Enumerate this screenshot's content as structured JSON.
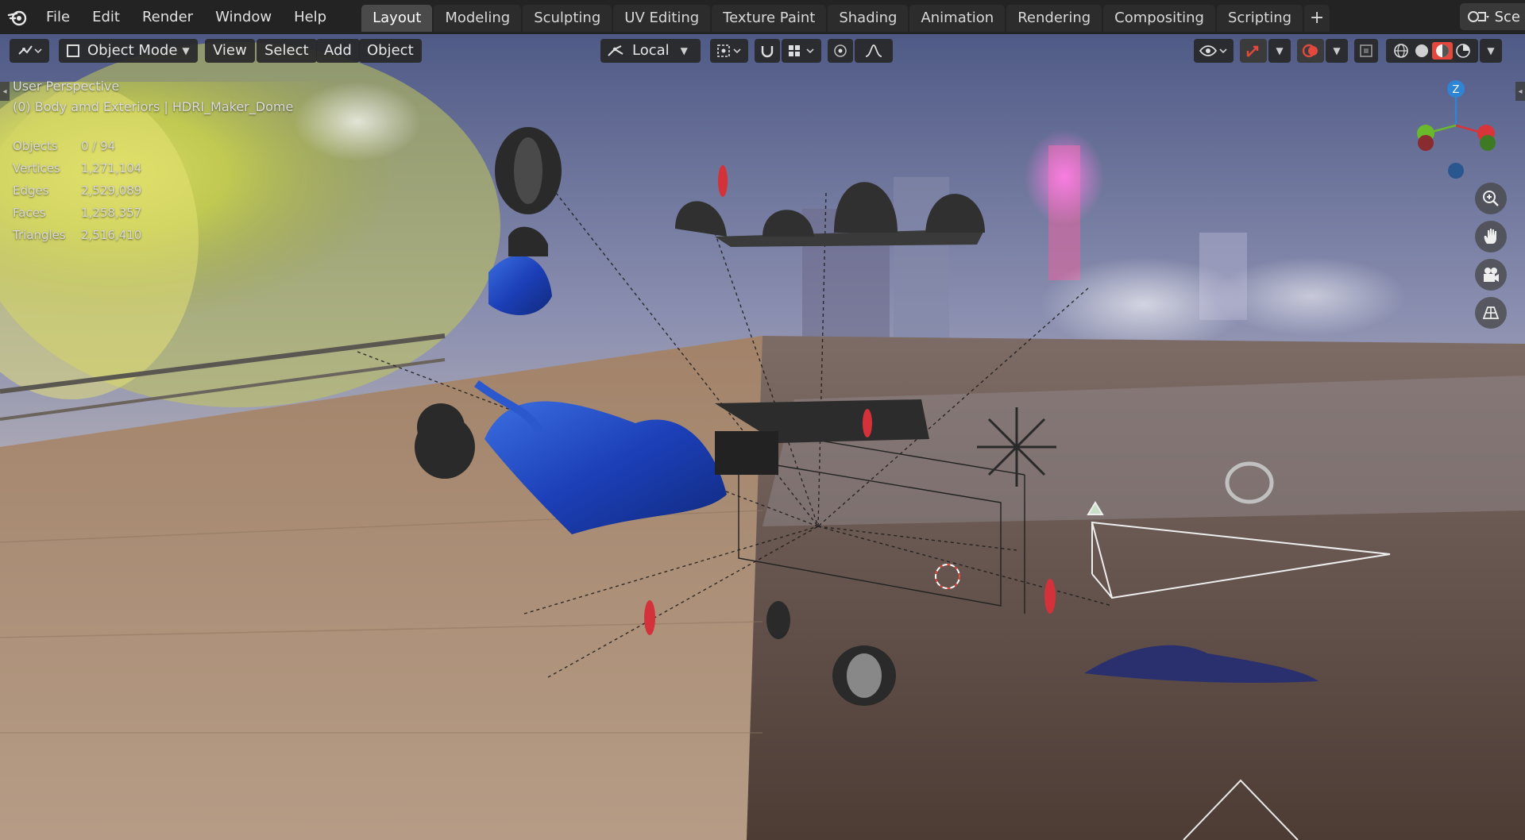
{
  "topbar": {
    "menus": [
      "File",
      "Edit",
      "Render",
      "Window",
      "Help"
    ],
    "tabs": [
      "Layout",
      "Modeling",
      "Sculpting",
      "UV Editing",
      "Texture Paint",
      "Shading",
      "Animation",
      "Rendering",
      "Compositing",
      "Scripting"
    ],
    "active_tab": "Layout",
    "add_tab": "+",
    "scene_label": "Sce"
  },
  "viewport_header": {
    "mode": "Object Mode",
    "view": "View",
    "select": "Select",
    "add": "Add",
    "object": "Object",
    "transform_orientation": "Local"
  },
  "overlay": {
    "perspective": "User Perspective",
    "collection": "(0) Body amd Exteriors | HDRI_Maker_Dome",
    "stats": [
      {
        "label": "Objects",
        "value": "0 / 94"
      },
      {
        "label": "Vertices",
        "value": "1,271,104"
      },
      {
        "label": "Edges",
        "value": "2,529,089"
      },
      {
        "label": "Faces",
        "value": "1,258,357"
      },
      {
        "label": "Triangles",
        "value": "2,516,410"
      }
    ]
  },
  "gizmo": {
    "z_label": "Z"
  },
  "colors": {
    "axis_x": "#d8353a",
    "axis_y": "#6ab92c",
    "axis_z": "#2f84d4",
    "accent_red": "#e2483d"
  }
}
